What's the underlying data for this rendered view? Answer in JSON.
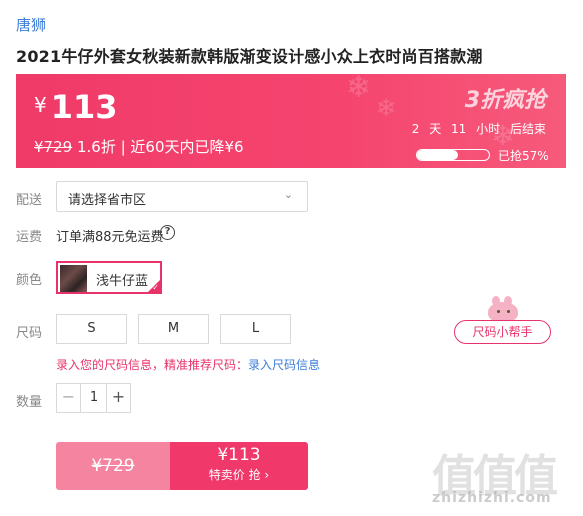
{
  "brand": "唐狮",
  "title": "2021牛仔外套女秋装新款韩版渐变设计感小众上衣时尚百搭款潮",
  "price": {
    "currency": "¥",
    "sale": "113",
    "original": "¥729",
    "discount": "1.6折",
    "recent_drop": "| 近60天内已降¥6",
    "flash_title": "3折疯抢",
    "countdown_days": "2",
    "countdown_days_unit": "天",
    "countdown_hours": "11",
    "countdown_hours_unit": "小时",
    "countdown_suffix": "后结束",
    "sold_percent": 57,
    "sold_label": "已抢57%"
  },
  "delivery": {
    "label": "配送",
    "placeholder": "请选择省市区"
  },
  "shipping": {
    "label": "运费",
    "text": "订单满88元免运费"
  },
  "color": {
    "label": "颜色",
    "selected": "浅牛仔蓝"
  },
  "size": {
    "label": "尺码",
    "options": [
      "S",
      "M",
      "L"
    ],
    "helper": "尺码小帮手",
    "tip": "录入您的尺码信息，精准推荐尺码：",
    "tip_link": "录入尺码信息"
  },
  "quantity": {
    "label": "数量",
    "value": "1",
    "minus": "−",
    "plus": "+"
  },
  "buy": {
    "original": "¥729",
    "price": "¥113",
    "action": "特卖价 抢 ›"
  },
  "watermark": {
    "logo": "值值值",
    "text": "zhizhizhi.com"
  },
  "colors": {
    "accent": "#f03a68",
    "link": "#3b7dd8"
  }
}
